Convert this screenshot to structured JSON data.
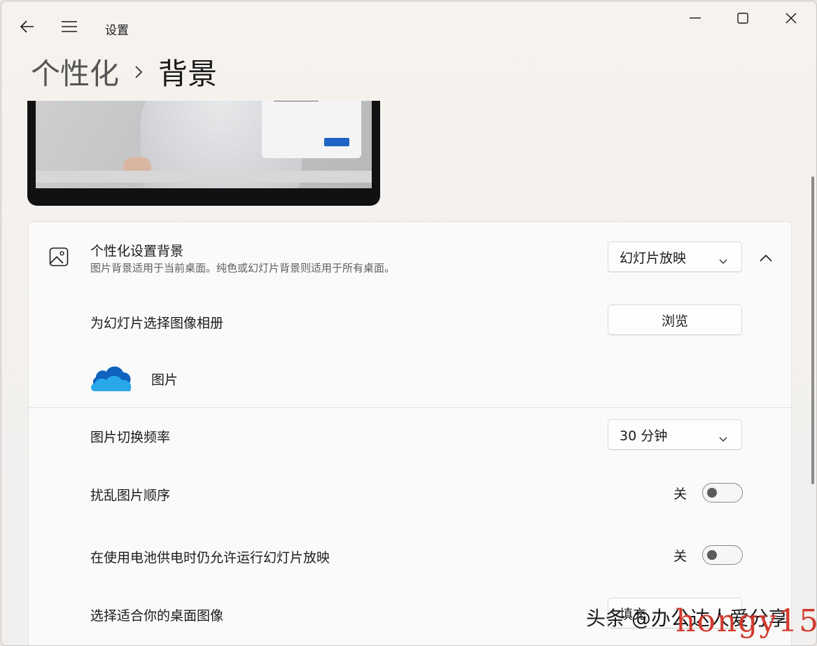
{
  "window": {
    "title": "设置"
  },
  "breadcrumb": {
    "parent": "个性化",
    "current": "背景"
  },
  "background_section": {
    "title": "个性化设置背景",
    "description": "图片背景适用于当前桌面。纯色或幻灯片背景则适用于所有桌面。",
    "type_value": "幻灯片放映"
  },
  "album": {
    "label": "为幻灯片选择图像相册",
    "browse_label": "浏览",
    "folder_name": "图片"
  },
  "frequency": {
    "label": "图片切换频率",
    "value": "30 分钟"
  },
  "shuffle": {
    "label": "扰乱图片顺序",
    "state": "关"
  },
  "battery": {
    "label": "在使用电池供电时仍允许运行幻灯片放映",
    "state": "关"
  },
  "fit": {
    "label": "选择适合你的桌面图像",
    "value": "填充"
  },
  "watermark": {
    "text": "头条 @办公达人爱分享",
    "text2": "hongy15"
  },
  "colors": {
    "accent": "#1f63c4",
    "onedrive_dark": "#0f62be",
    "onedrive_light": "#28a8ea"
  }
}
